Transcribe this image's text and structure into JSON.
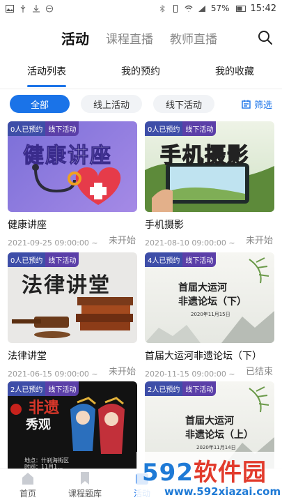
{
  "status_bar": {
    "battery": "57%",
    "time": "15:42"
  },
  "header": {
    "tabs": [
      {
        "label": "活动"
      },
      {
        "label": "课程直播"
      },
      {
        "label": "教师直播"
      }
    ]
  },
  "subtabs": [
    {
      "label": "活动列表"
    },
    {
      "label": "我的预约"
    },
    {
      "label": "我的收藏"
    }
  ],
  "chips": [
    {
      "label": "全部"
    },
    {
      "label": "线上活动"
    },
    {
      "label": "线下活动"
    }
  ],
  "filter_label": "筛选",
  "cards": [
    {
      "count": "0人已预约",
      "type": "线下活动",
      "title": "健康讲座",
      "date": "2021-09-25 09:00:00 ~",
      "status": "未开始",
      "art": "健康讲座"
    },
    {
      "count": "0人已预约",
      "type": "线下活动",
      "title": "手机摄影",
      "date": "2021-08-10 09:00:00 ~",
      "status": "未开始",
      "art": "手机摄影"
    },
    {
      "count": "0人已预约",
      "type": "线下活动",
      "title": "法律讲堂",
      "date": "2021-06-15 09:00:00 ~",
      "status": "未开始",
      "art": "法律讲堂"
    },
    {
      "count": "4人已预约",
      "type": "线下活动",
      "title": "首届大运河非遗论坛（下）",
      "date": "2020-11-15 09:00:00 ~",
      "status": "已结束",
      "art_line1": "首届大运河",
      "art_line2": "非遗论坛（下）",
      "art_date": "2020年11月15日"
    },
    {
      "count": "2人已预约",
      "type": "线下活动",
      "art_vert": "非遗",
      "art_sub": "秀观",
      "art_addr": "地点：什刹海街区",
      "art_time": "时间：11月1…"
    },
    {
      "count": "2人已预约",
      "type": "线下活动",
      "art_line1": "首届大运河",
      "art_line2": "非遗论坛（上）",
      "art_date": "2020年11月14日"
    }
  ],
  "bottom_nav": [
    {
      "label": "首页"
    },
    {
      "label": "课程题库"
    },
    {
      "label": "活动"
    }
  ],
  "watermark": {
    "brand_num": "592",
    "brand_cn": "软件园",
    "url": "www.592xiazai.com"
  },
  "colors": {
    "accent": "#1a73e8",
    "badge_count": "#3e4ea8",
    "badge_type": "#5b3fa8"
  }
}
